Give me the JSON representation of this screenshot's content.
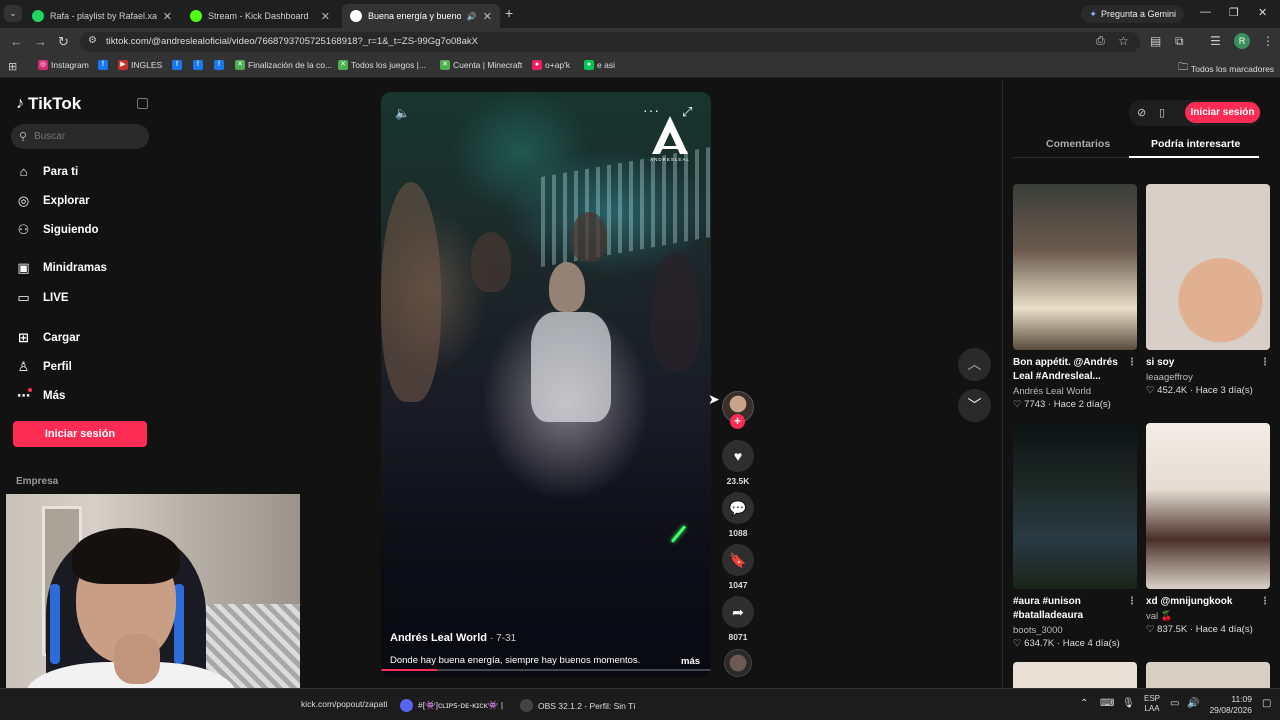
{
  "browser": {
    "tabs": [
      {
        "title": "Rafa - playlist by Rafael.xared |",
        "color": "#1ed760",
        "active": false
      },
      {
        "title": "Stream - Kick Dashboard",
        "color": "#53fc18",
        "active": false
      },
      {
        "title": "Buena energía y buenos m",
        "color": "#ffffff",
        "active": true
      }
    ],
    "gemini_label": "Pregunta a Gemini",
    "url": "tiktok.com/@andreslealoficial/video/7668793705725168918?_r=1&_t=ZS-99Gg7o08akX",
    "profile_initial": "R",
    "bookmarks": [
      {
        "label": "Instagram",
        "color": "#d62976",
        "glyph": "◎"
      },
      {
        "label": "",
        "color": "#1877f2",
        "glyph": "f"
      },
      {
        "label": "INGLES",
        "color": "#c4302b",
        "glyph": "▶"
      },
      {
        "label": "",
        "color": "#1877f2",
        "glyph": "f"
      },
      {
        "label": "",
        "color": "#1877f2",
        "glyph": "f"
      },
      {
        "label": "",
        "color": "#1877f2",
        "glyph": "f"
      },
      {
        "label": "Finalización de la co...",
        "color": "#4caf50",
        "glyph": "✕"
      },
      {
        "label": "Todos los juegos |...",
        "color": "#4caf50",
        "glyph": "✕"
      },
      {
        "label": "Cuenta | Minecraft",
        "color": "#4caf50",
        "glyph": "✕"
      },
      {
        "label": "o+ap'k",
        "color": "#e91e63",
        "glyph": "●"
      },
      {
        "label": "e asi",
        "color": "#00c853",
        "glyph": "●"
      }
    ],
    "all_bookmarks": "Todos los marcadores"
  },
  "sidebar": {
    "logo": "TikTok",
    "search_placeholder": "Buscar",
    "items": [
      {
        "label": "Para ti",
        "icon": "home-icon",
        "glyph": "⌂"
      },
      {
        "label": "Explorar",
        "icon": "compass-icon",
        "glyph": "◎"
      },
      {
        "label": "Siguiendo",
        "icon": "following-icon",
        "glyph": "⚇"
      },
      {
        "label": "Minidramas",
        "icon": "film-icon",
        "glyph": "▣"
      },
      {
        "label": "LIVE",
        "icon": "live-icon",
        "glyph": "▭"
      },
      {
        "label": "Cargar",
        "icon": "upload-icon",
        "glyph": "⊞"
      },
      {
        "label": "Perfil",
        "icon": "profile-icon",
        "glyph": "♙"
      },
      {
        "label": "Más",
        "icon": "more-icon",
        "glyph": "⋯"
      }
    ],
    "login_label": "Iniciar sesión",
    "empresa": "Empresa"
  },
  "video": {
    "author": "Andrés Leal World",
    "date": "· 7-31",
    "caption": "Donde hay buena energía, siempre hay buenos momentos.",
    "more": "más",
    "progress": 0.17,
    "likes": "23.5K",
    "comments": "1088",
    "saves": "1047",
    "shares": "8071"
  },
  "right_panel": {
    "login_label": "Iniciar sesión",
    "tabs": [
      "Comentarios",
      "Podría interesarte"
    ],
    "active_tab": 1,
    "cards": [
      {
        "title": "Bon appétit. @Andrés Leal #Andresleal...",
        "author": "Andrés Leal World",
        "likes": "7743",
        "ago": "Hace 2 día(s)",
        "thumb": "linear-gradient(180deg,#3a3e3a 0%,#6b5a4e 40%,#e8dfc8 75%,#5a4a3c 100%)"
      },
      {
        "title": "si soy",
        "author": "leaageffroy",
        "likes": "452.4K",
        "ago": "Hace 3 día(s)",
        "thumb": "radial-gradient(circle at 60% 70%,#e0b090 0 30%,#d7cfc8 31%)"
      },
      {
        "title": "#aura #unison #batalladeaura",
        "author": "boots_3000",
        "likes": "634.7K",
        "ago": "Hace 4 día(s)",
        "thumb": "linear-gradient(180deg,#0d1414 0%,#1e2a26 40%,#2a3a44 70%,#1a2418 100%)"
      },
      {
        "title": "xd @mnijungkook",
        "author": "val 🍒",
        "likes": "837.5K",
        "ago": "Hace 4 día(s)",
        "thumb": "linear-gradient(180deg,#f1ede6 0%,#e4dcd2 40%,#4a2e2a 70%,#d9d2c8 100%)"
      }
    ]
  },
  "taskbar": {
    "items": [
      {
        "label": "kick.com/popout/zapati",
        "color": "#53fc18"
      },
      {
        "label": "#[👾]ᴄʟɪᴘꜱ-ᴅᴇ-ᴋɪᴄᴋ👾 |",
        "color": "#5865f2"
      },
      {
        "label": "OBS 32.1.2 - Perfil: Sin Tí",
        "color": "#444444"
      }
    ],
    "lang_top": "ESP",
    "lang_bottom": "LAA",
    "time": "11:09",
    "date": "29/08/2026"
  }
}
